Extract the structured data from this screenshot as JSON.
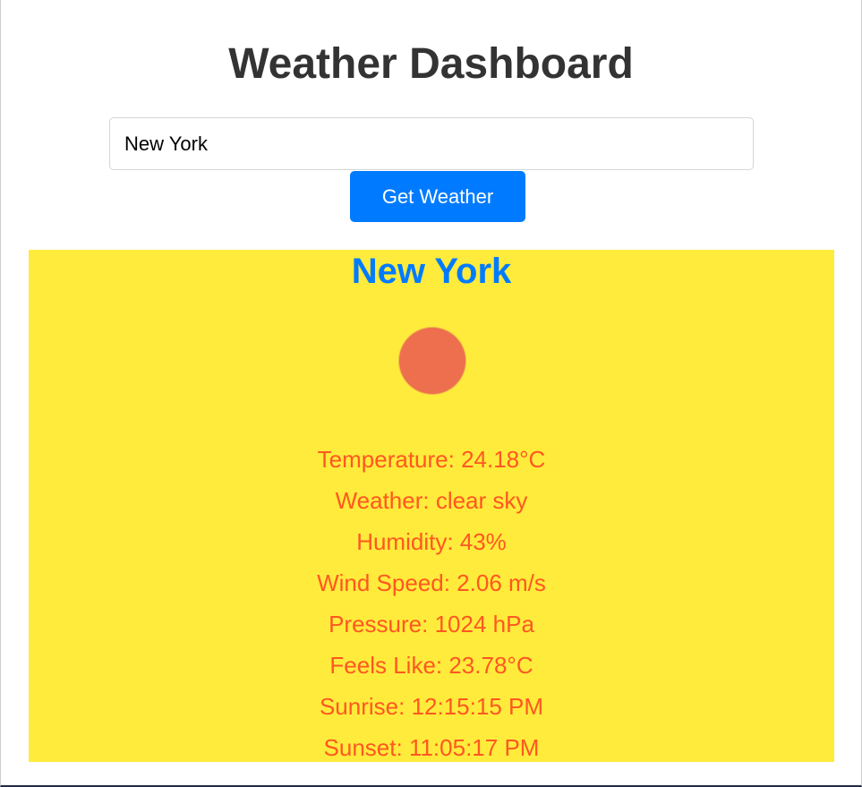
{
  "header": {
    "title": "Weather Dashboard"
  },
  "search": {
    "value": "New York",
    "button_label": "Get Weather"
  },
  "weather": {
    "city": "New York",
    "icon": "sun-icon",
    "details": [
      "Temperature: 24.18°C",
      "Weather: clear sky",
      "Humidity: 43%",
      "Wind Speed: 2.06 m/s",
      "Pressure: 1024 hPa",
      "Feels Like: 23.78°C",
      "Sunrise: 12:15:15 PM",
      "Sunset: 11:05:17 PM"
    ]
  },
  "colors": {
    "title": "#333333",
    "button": "#007bff",
    "card_background": "#ffeb3b",
    "city_name": "#007bff",
    "detail_text": "#ff5722",
    "sun": "#ed6f4e"
  }
}
